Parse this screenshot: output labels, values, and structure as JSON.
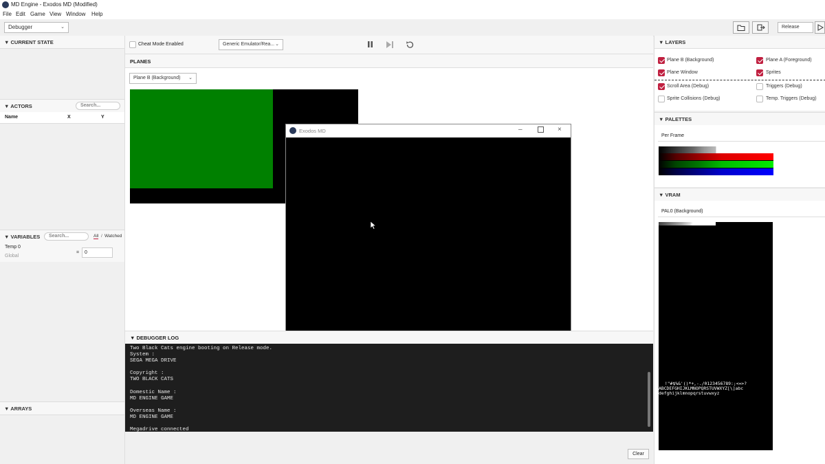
{
  "window": {
    "title": "MD Engine - Exodos MD (Modified)"
  },
  "menu": [
    "File",
    "Edit",
    "Game",
    "View",
    "Window",
    "Help"
  ],
  "toolbar": {
    "mode": "Debugger",
    "build": "Release"
  },
  "left": {
    "current_state": "CURRENT STATE",
    "actors": {
      "title": "ACTORS",
      "search": "Search...",
      "col_name": "Name",
      "col_x": "X",
      "col_y": "Y"
    },
    "variables": {
      "title": "VARIABLES",
      "search": "Search...",
      "tab_all": "All",
      "tab_sep": "/",
      "tab_watched": "Watched",
      "var_name": "Temp 0",
      "var_scope": "Global",
      "eq": "=",
      "var_value": "0"
    },
    "arrays": "ARRAYS"
  },
  "center": {
    "cheat_label": "Cheat Mode Enabled",
    "emulator": "Generic Emulator/Rea...",
    "planes_title": "PLANES",
    "plane_select": "Plane B (Background)",
    "plane_colors": {
      "bg": "#000000",
      "fill": "#008000"
    },
    "emu_window_title": "Exodos MD",
    "log_title": "DEBUGGER LOG",
    "log_text": "Two Black Cats engine booting on Release mode.\nSystem :\nSEGA MEGA DRIVE\n\nCopyright :\nTWO BLACK CATS\n\nDomestic Name :\nMD ENGINE GAME\n\nOverseas Name :\nMD ENGINE GAME\n\nMegadrive connected\nTwo Black Cats engine booting on Release mode.",
    "clear": "Clear"
  },
  "right": {
    "layers_title": "LAYERS",
    "layers": {
      "plane_b": {
        "label": "Plane B (Background)",
        "checked": true
      },
      "plane_a": {
        "label": "Plane A (Foreground)",
        "checked": true
      },
      "plane_window": {
        "label": "Plane Window",
        "checked": true
      },
      "sprites": {
        "label": "Sprites",
        "checked": true
      },
      "scroll_area": {
        "label": "Scroll Area (Debug)",
        "checked": true
      },
      "triggers": {
        "label": "Triggers (Debug)",
        "checked": false
      },
      "sprite_collisions": {
        "label": "Sprite Collisions (Debug)",
        "checked": false
      },
      "temp_triggers": {
        "label": "Temp. Triggers (Debug)",
        "checked": false
      }
    },
    "palettes_title": "PALETTES",
    "palette_select": "Per Frame",
    "vram_title": "VRAM",
    "vram_select": "PAL0 (Background)",
    "font_line1": " !\"#$%&'()*+,-./0123456789:;<=>?",
    "font_line2": "ABCDEFGHIJKLMNOPQRSTUVWXYZ[\\]abc",
    "font_line3": "defghijklmnopqrstuvwxyz"
  }
}
